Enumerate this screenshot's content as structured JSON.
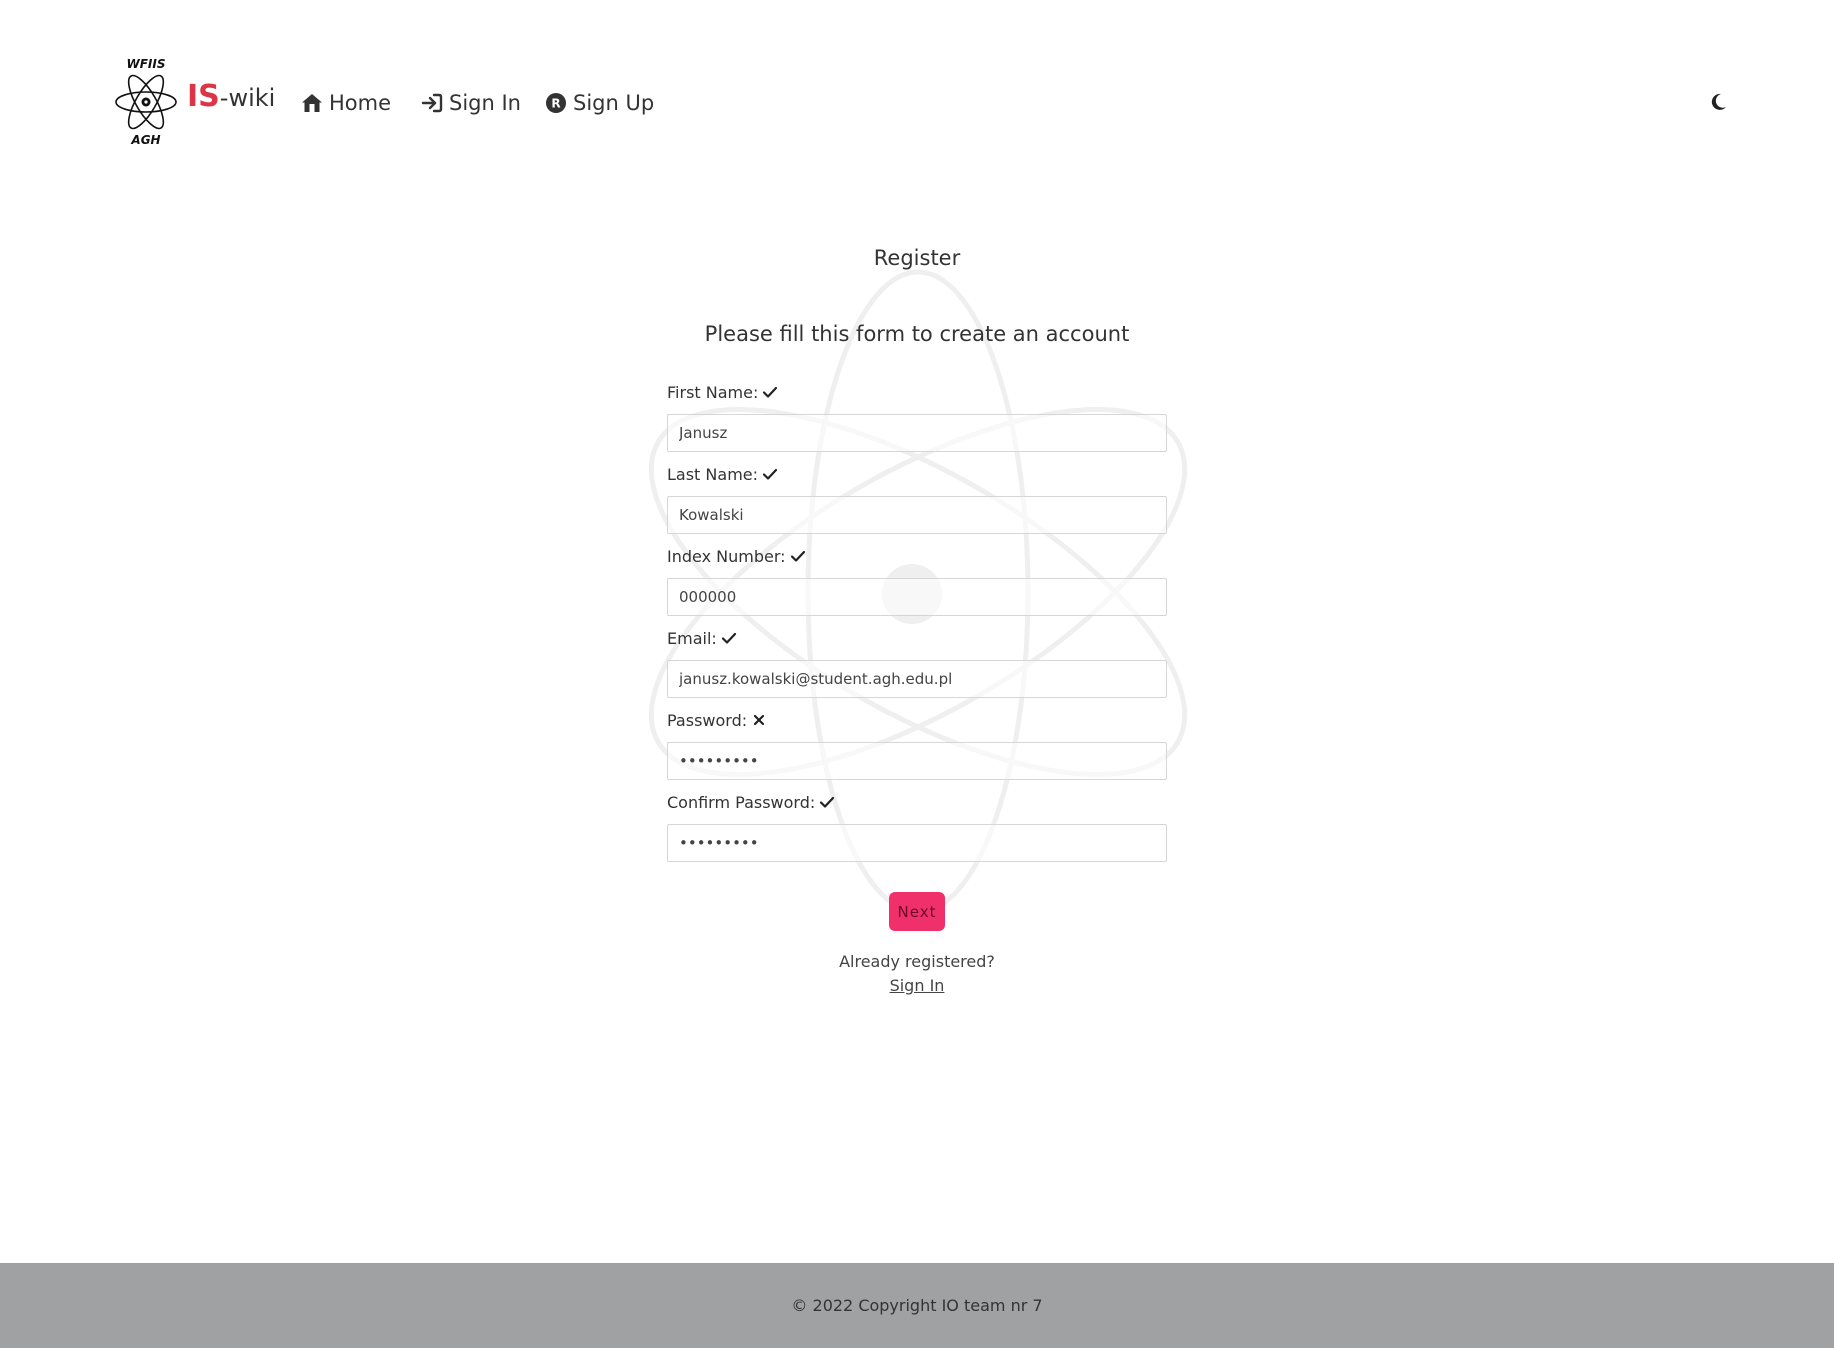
{
  "brand": {
    "logo_top_text": "WFIIS",
    "logo_bottom_text": "AGH",
    "name_main": "IS",
    "name_suffix": "-wiki",
    "accent_color": "#dc3545"
  },
  "nav": {
    "items": [
      {
        "label": "Home",
        "icon": "house-icon"
      },
      {
        "label": "Sign In",
        "icon": "sign-in-arrow-icon"
      },
      {
        "label": "Sign Up",
        "icon": "registered-circle-icon"
      }
    ],
    "theme_toggle_icon": "moon-icon"
  },
  "form": {
    "title": "Register",
    "subtitle": "Please fill this form to create an account",
    "fields": [
      {
        "label": "First Name:",
        "value": "Janusz",
        "valid": true,
        "type": "text"
      },
      {
        "label": "Last Name:",
        "value": "Kowalski",
        "valid": true,
        "type": "text"
      },
      {
        "label": "Index Number:",
        "value": "000000",
        "valid": true,
        "type": "text"
      },
      {
        "label": "Email:",
        "value": "janusz.kowalski@student.agh.edu.pl",
        "valid": true,
        "type": "text"
      },
      {
        "label": "Password:",
        "value": "•••••••••",
        "valid": false,
        "type": "password"
      },
      {
        "label": "Confirm Password:",
        "value": "•••••••••",
        "valid": true,
        "type": "password"
      }
    ],
    "next_label": "Next",
    "button_color": "#f0306a",
    "already_registered": "Already registered?",
    "signin_link": "Sign In"
  },
  "footer": {
    "text": "© 2022 Copyright IO team nr 7",
    "background": "#a0a1a2"
  }
}
